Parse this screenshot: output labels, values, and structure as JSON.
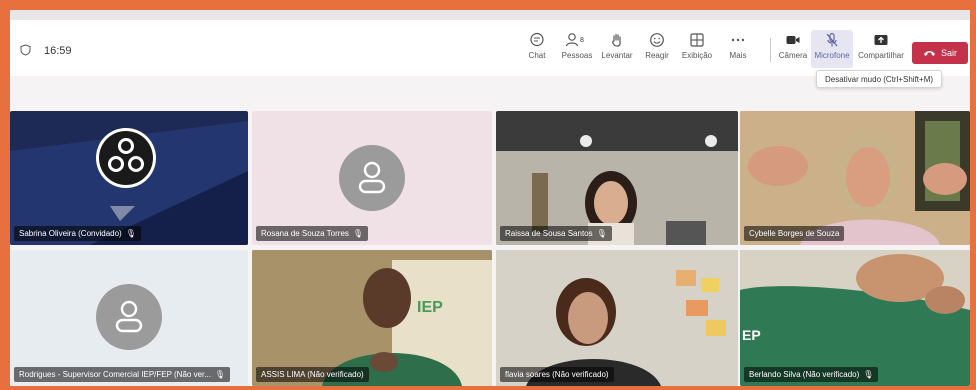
{
  "toolbar": {
    "time": "16:59",
    "chat": "Chat",
    "people": "Pessoas",
    "people_count": "8",
    "raise": "Levantar",
    "react": "Reagir",
    "view": "Exibição",
    "more": "Mais",
    "camera": "Câmera",
    "mic": "Microfone",
    "share": "Compartilhar",
    "leave": "Sair",
    "tooltip": "Desativar mudo (Ctrl+Shift+M)"
  },
  "participants": [
    {
      "name": "Sabrina Oliveira (Convidado)"
    },
    {
      "name": "Rosana de Souza Torres"
    },
    {
      "name": "Raissa de Sousa Santos"
    },
    {
      "name": "Cybelle Borges de Souza"
    },
    {
      "name": "Rodrigues - Supervisor Comercial IEP/FEP (Não ver..."
    },
    {
      "name": "ASSIS LIMA (Não verificado)"
    },
    {
      "name": "flavia soares (Não verificado)"
    },
    {
      "name": "Berlando Silva (Não verificado)"
    }
  ],
  "icons": {
    "colors": {
      "accent": "#6264a7",
      "leave": "#c4314b",
      "border": "#e8703f"
    }
  }
}
